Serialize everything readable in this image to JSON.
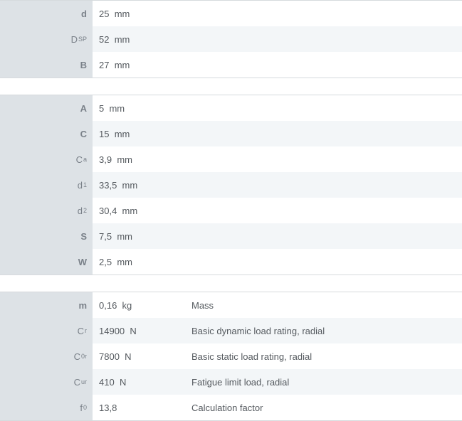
{
  "groups": [
    {
      "rows": [
        {
          "sym": "d",
          "sub": "",
          "value": "25",
          "unit": "mm",
          "desc": ""
        },
        {
          "sym": "D",
          "sub": "SP",
          "value": "52",
          "unit": "mm",
          "desc": ""
        },
        {
          "sym": "B",
          "sub": "",
          "value": "27",
          "unit": "mm",
          "desc": ""
        }
      ]
    },
    {
      "rows": [
        {
          "sym": "A",
          "sub": "",
          "value": "5",
          "unit": "mm",
          "desc": ""
        },
        {
          "sym": "C",
          "sub": "",
          "value": "15",
          "unit": "mm",
          "desc": ""
        },
        {
          "sym": "C",
          "sub": "a",
          "value": "3,9",
          "unit": "mm",
          "desc": ""
        },
        {
          "sym": "d",
          "sub": "1",
          "value": "33,5",
          "unit": "mm",
          "desc": ""
        },
        {
          "sym": "d",
          "sub": "2",
          "value": "30,4",
          "unit": "mm",
          "desc": ""
        },
        {
          "sym": "S",
          "sub": "",
          "value": "7,5",
          "unit": "mm",
          "desc": ""
        },
        {
          "sym": "W",
          "sub": "",
          "value": "2,5",
          "unit": "mm",
          "desc": ""
        }
      ]
    },
    {
      "rows": [
        {
          "sym": "m",
          "sub": "",
          "value": "0,16",
          "unit": "kg",
          "desc": "Mass"
        },
        {
          "sym": "C",
          "sub": "r",
          "value": "14900",
          "unit": "N",
          "desc": "Basic dynamic load rating, radial"
        },
        {
          "sym": "C",
          "sub": "0r",
          "value": "7800",
          "unit": "N",
          "desc": "Basic static load rating, radial"
        },
        {
          "sym": "C",
          "sub": "ur",
          "value": "410",
          "unit": "N",
          "desc": "Fatigue limit load, radial"
        },
        {
          "sym": "f",
          "sub": "0",
          "value": "13,8",
          "unit": "",
          "desc": "Calculation factor"
        }
      ]
    }
  ]
}
